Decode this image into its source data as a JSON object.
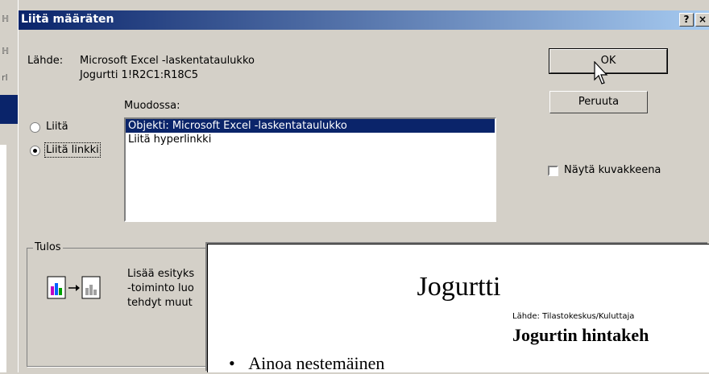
{
  "dialog": {
    "title": "Liitä määräten",
    "help_button": "?",
    "close_button": "×",
    "source_label": "Lähde:",
    "source_line1": "Microsoft Excel -laskentataulukko",
    "source_line2": "Jogurtti 1!R2C1:R18C5",
    "format_label": "Muodossa:",
    "radio_paste": "Liitä",
    "radio_paste_link": "Liitä linkki",
    "list_items": [
      "Objekti: Microsoft Excel -laskentataulukko",
      "Liitä hyperlinkki"
    ],
    "ok_button": "OK",
    "cancel_button": "Peruuta",
    "show_icon_label": "Näytä kuvakkeena",
    "result_label": "Tulos",
    "result_text": [
      "Lisää esityks",
      "-toiminto luo",
      "tehdyt muut"
    ]
  },
  "background_window": {
    "fragments": [
      "ℍ",
      "ℍ",
      "rⅠ"
    ]
  },
  "slide": {
    "title": "Jogurtti",
    "source": "Lähde: Tilastokeskus/Kuluttaja",
    "chart_title": "Jogurtin hintakeh",
    "bullet": "Ainoa nestemäinen"
  },
  "colors": {
    "titlebar_start": "#0a246a",
    "titlebar_end": "#a6caf0",
    "selection": "#0a246a"
  }
}
